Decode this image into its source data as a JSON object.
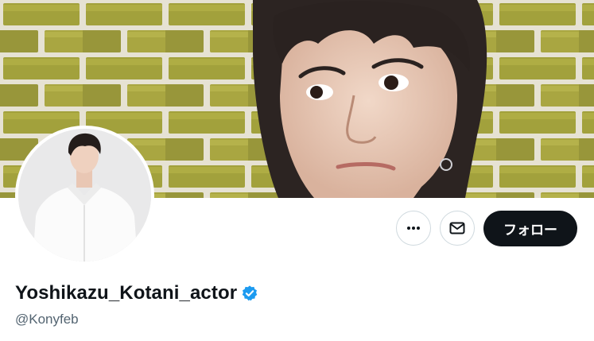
{
  "profile": {
    "display_name": "Yoshikazu_Kotani_actor",
    "handle": "@Konyfeb",
    "verified": true
  },
  "actions": {
    "more_icon": "more-horizontal-icon",
    "message_icon": "envelope-icon",
    "follow_label": "フォロー"
  },
  "colors": {
    "follow_bg": "#0f1419",
    "verified_badge": "#1d9bf0",
    "handle_text": "#536471",
    "button_border": "#cfd9de"
  }
}
